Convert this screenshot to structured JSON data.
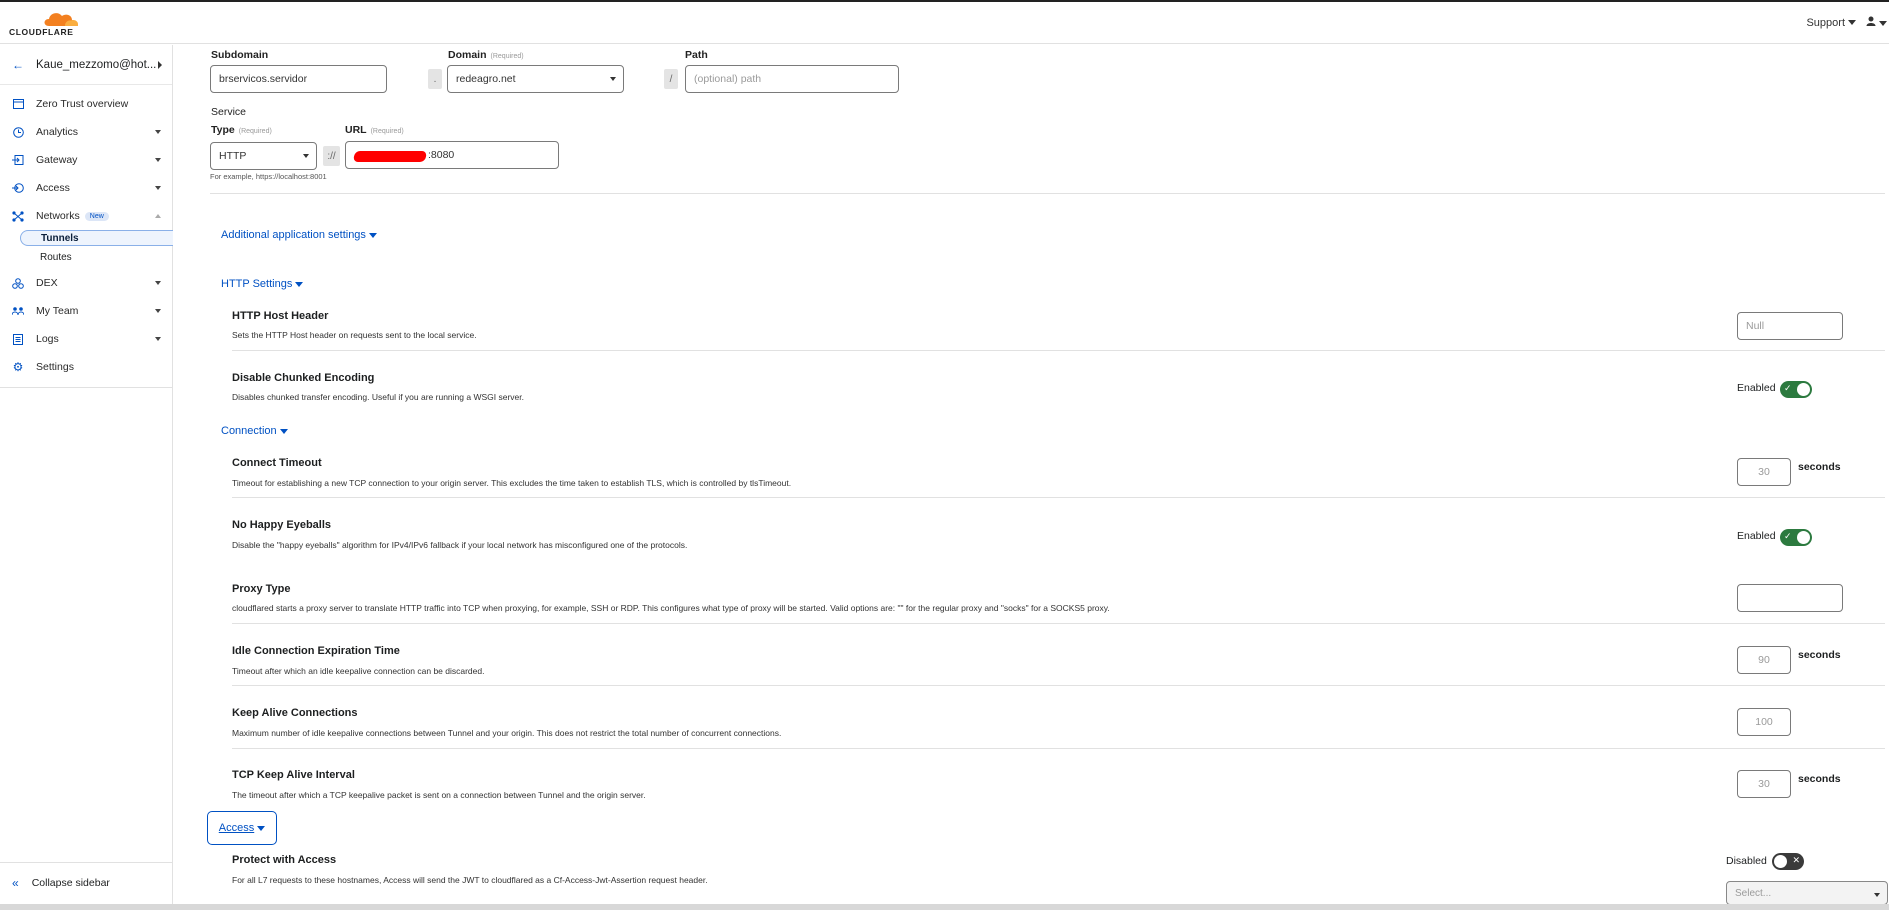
{
  "header": {
    "logo_text": "CLOUDFLARE",
    "support_label": "Support",
    "user_icon": "user-icon"
  },
  "sidebar": {
    "account": "Kaue_mezzomo@hot...",
    "items": [
      {
        "label": "Zero Trust overview",
        "icon": "window-icon"
      },
      {
        "label": "Analytics",
        "icon": "clock-icon"
      },
      {
        "label": "Gateway",
        "icon": "gateway-icon"
      },
      {
        "label": "Access",
        "icon": "access-icon"
      },
      {
        "label": "Networks",
        "icon": "network-icon",
        "badge": "New"
      },
      {
        "label": "DEX",
        "icon": "dex-icon"
      },
      {
        "label": "My Team",
        "icon": "team-icon"
      },
      {
        "label": "Logs",
        "icon": "logs-icon"
      },
      {
        "label": "Settings",
        "icon": "gear-icon"
      }
    ],
    "subitems": [
      {
        "label": "Tunnels",
        "active": true
      },
      {
        "label": "Routes",
        "active": false
      }
    ],
    "collapse_label": "Collapse sidebar"
  },
  "hostname": {
    "subdomain_label": "Subdomain",
    "subdomain_value": "brservicos.servidor",
    "domain_label": "Domain",
    "domain_required": "(Required)",
    "domain_value": "redeagro.net",
    "path_label": "Path",
    "path_placeholder": "(optional) path",
    "dot_sep": ".",
    "slash_sep": "/"
  },
  "service": {
    "heading": "Service",
    "type_label": "Type",
    "type_required": "(Required)",
    "type_value": "HTTP",
    "scheme_sep": "://",
    "url_label": "URL",
    "url_required": "(Required)",
    "url_value": ":8080",
    "hint": "For example, https://localhost:8001"
  },
  "links": {
    "additional": "Additional application settings",
    "http": "HTTP Settings",
    "connection": "Connection",
    "access": "Access"
  },
  "settings": [
    {
      "title": "HTTP Host Header",
      "desc": "Sets the HTTP Host header on requests sent to the local service.",
      "control": "input",
      "placeholder": "Null"
    },
    {
      "title": "Disable Chunked Encoding",
      "desc": "Disables chunked transfer encoding. Useful if you are running a WSGI server.",
      "control": "toggle",
      "state": "Enabled"
    },
    {
      "title": "Connect Timeout",
      "desc": "Timeout for establishing a new TCP connection to your origin server. This excludes the time taken to establish TLS, which is controlled by tlsTimeout.",
      "control": "number",
      "value": "30",
      "unit": "seconds"
    },
    {
      "title": "No Happy Eyeballs",
      "desc": "Disable the \"happy eyeballs\" algorithm for IPv4/IPv6 fallback if your local network has misconfigured one of the protocols.",
      "control": "toggle",
      "state": "Enabled"
    },
    {
      "title": "Proxy Type",
      "desc": "cloudflared starts a proxy server to translate HTTP traffic into TCP when proxying, for example, SSH or RDP. This configures what type of proxy will be started. Valid options are: \"\" for the regular proxy and \"socks\" for a SOCKS5 proxy.",
      "control": "input",
      "placeholder": ""
    },
    {
      "title": "Idle Connection Expiration Time",
      "desc": "Timeout after which an idle keepalive connection can be discarded.",
      "control": "number",
      "value": "90",
      "unit": "seconds"
    },
    {
      "title": "Keep Alive Connections",
      "desc": "Maximum number of idle keepalive connections between Tunnel and your origin. This does not restrict the total number of concurrent connections.",
      "control": "number",
      "value": "100",
      "unit": ""
    },
    {
      "title": "TCP Keep Alive Interval",
      "desc": "The timeout after which a TCP keepalive packet is sent on a connection between Tunnel and the origin server.",
      "control": "number",
      "value": "30",
      "unit": "seconds"
    },
    {
      "title": "Protect with Access",
      "desc": "For all L7 requests to these hostnames, Access will send the JWT to cloudflared as a Cf-Access-Jwt-Assertion request header.",
      "control": "toggle",
      "state": "Disabled"
    }
  ],
  "access_select_placeholder": "Select..."
}
